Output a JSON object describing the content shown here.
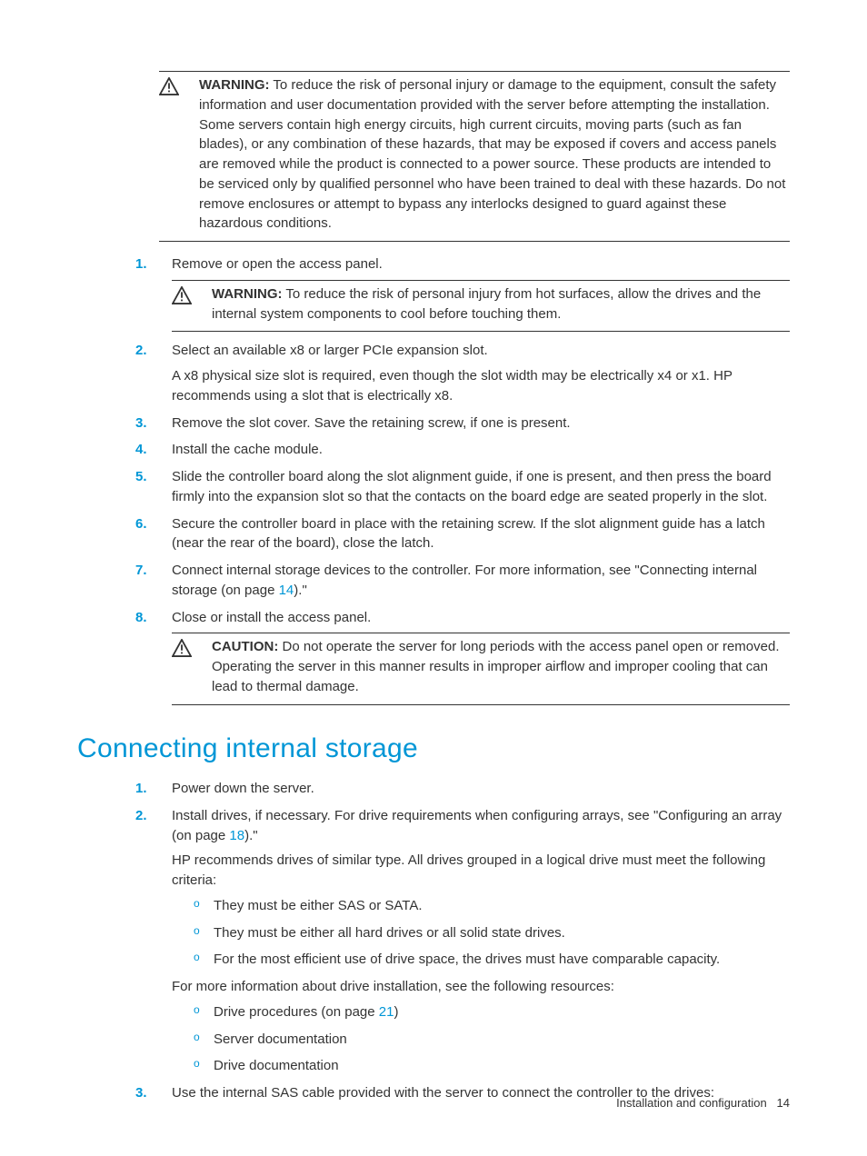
{
  "warning1": {
    "label": "WARNING:",
    "text": "To reduce the risk of personal injury or damage to the equipment, consult the safety information and user documentation provided with the server before attempting the installation. Some servers contain high energy circuits, high current circuits, moving parts (such as fan blades), or any combination of these hazards, that may be exposed if covers and access panels are removed while the product is connected to a power source. These products are intended to be serviced only by qualified personnel who have been trained to deal with these hazards. Do not remove enclosures or attempt to bypass any interlocks designed to guard against these hazardous conditions."
  },
  "steps_a": [
    {
      "n": "1.",
      "text": "Remove or open the access panel."
    }
  ],
  "warning2": {
    "label": "WARNING:",
    "text": "To reduce the risk of personal injury from hot surfaces, allow the drives and the internal system components to cool before touching them."
  },
  "steps_b": [
    {
      "n": "2.",
      "text": "Select an available x8 or larger PCIe expansion slot.",
      "para2": "A x8 physical size slot is required, even though the slot width may be electrically x4 or x1. HP recommends using a slot that is electrically x8."
    },
    {
      "n": "3.",
      "text": "Remove the slot cover. Save the retaining screw, if one is present."
    },
    {
      "n": "4.",
      "text": "Install the cache module."
    },
    {
      "n": "5.",
      "text": "Slide the controller board along the slot alignment guide, if one is present, and then press the board firmly into the expansion slot so that the contacts on the board edge are seated properly in the slot."
    },
    {
      "n": "6.",
      "text": "Secure the controller board in place with the retaining screw. If the slot alignment guide has a latch (near the rear of the board), close the latch."
    },
    {
      "n": "7.",
      "pre": "Connect internal storage devices to the controller. For more information, see \"Connecting internal storage (on page ",
      "link": "14",
      "post": ").\""
    },
    {
      "n": "8.",
      "text": "Close or install the access panel."
    }
  ],
  "caution": {
    "label": "CAUTION:",
    "text": "Do not operate the server for long periods with the access panel open or removed. Operating the server in this manner results in improper airflow and improper cooling that can lead to thermal damage."
  },
  "heading": "Connecting internal storage",
  "steps_c": [
    {
      "n": "1.",
      "text": "Power down the server."
    },
    {
      "n": "2.",
      "pre": "Install drives, if necessary. For drive requirements when configuring arrays, see \"Configuring an array (on page ",
      "link": "18",
      "post": ").\"",
      "para2": "HP recommends drives of similar type. All drives grouped in a logical drive must meet the following criteria:",
      "bullets1": [
        "They must be either SAS or SATA.",
        "They must be either all hard drives or all solid state drives.",
        "For the most efficient use of drive space, the drives must have comparable capacity."
      ],
      "para3": "For more information about drive installation, see the following resources:",
      "bullets2_0_pre": "Drive procedures (on page ",
      "bullets2_0_link": "21",
      "bullets2_0_post": ")",
      "bullets2_rest": [
        "Server documentation",
        "Drive documentation"
      ]
    },
    {
      "n": "3.",
      "text": "Use the internal SAS cable provided with the server to connect the controller to the drives:"
    }
  ],
  "footer": {
    "section": "Installation and configuration",
    "page": "14"
  }
}
